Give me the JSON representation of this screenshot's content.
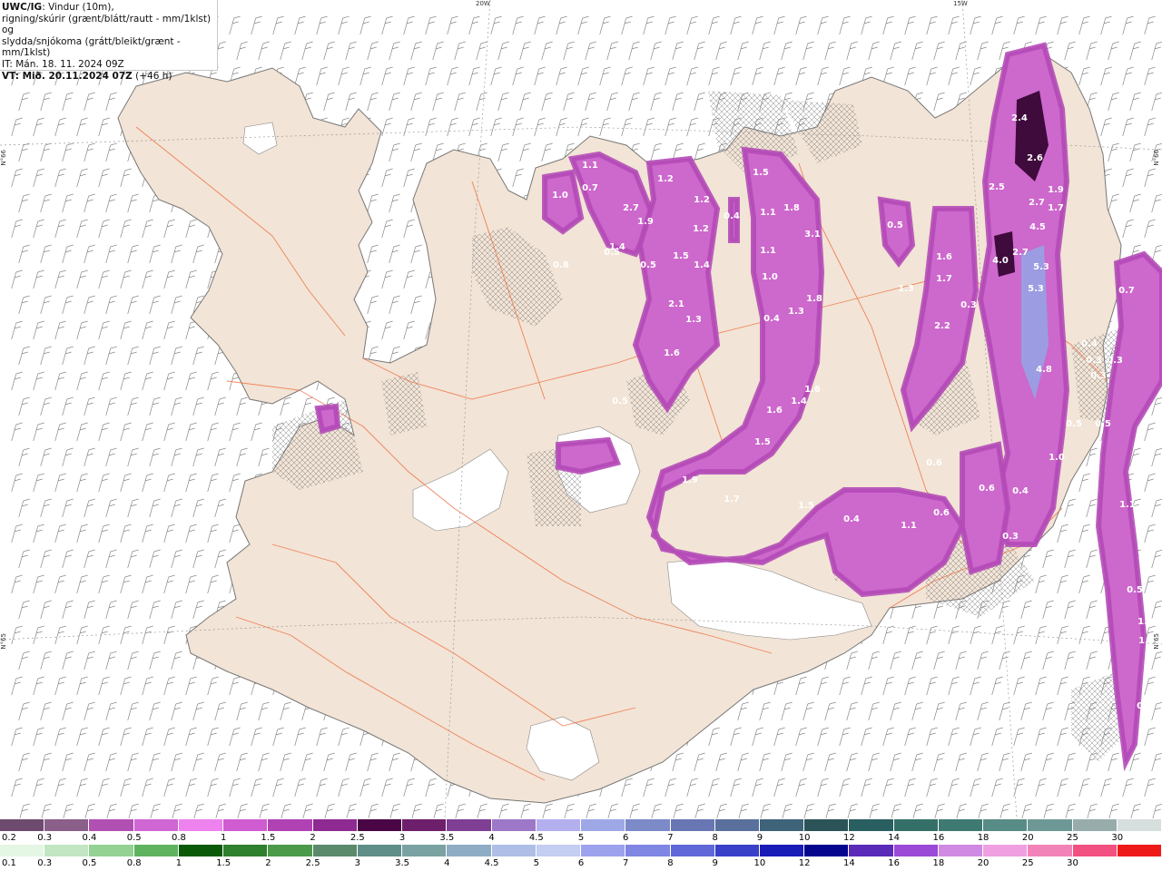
{
  "header": {
    "title_bold": "UWC/IG",
    "line1_rest": ": Vindur (10m),",
    "line2": "rigning/skúrir (grænt/blátt/rautt - mm/1klst) og",
    "line3": "slydda/snjókoma (grátt/bleikt/grænt - mm/1klst)",
    "line4": "IT: Mán. 18. 11. 2024 09Z",
    "line5_bold": "VT: Mið. 20.11.2024 07Z",
    "line5_rest": " (+46 h)"
  },
  "graticule": {
    "lon_labels": [
      "20W",
      "15W"
    ],
    "lat_labels_left": [
      "N°66",
      "N°65"
    ],
    "lat_labels_right": [
      "N°66",
      "N°65"
    ]
  },
  "colors": {
    "sea": "#ffffff",
    "land": "#f2e4d6",
    "coast": "#777777",
    "roads": "#ee6a3a",
    "glacier": "#ffffff",
    "precip_light": "#ee82ee",
    "precip_medium": "#b54ab8",
    "precip_heavy": "#6c1f67",
    "precip_dark": "#3f0a3c",
    "precip_blue": "#9c9ce2"
  },
  "precip_values": [
    "1.1",
    "1.0",
    "0.7",
    "0.8",
    "1.2",
    "2.7",
    "1.9",
    "1.4",
    "1.2",
    "1.2",
    "1.4",
    "1.5",
    "0.5",
    "0.5",
    "2.1",
    "1.3",
    "1.6",
    "0.4",
    "1.5",
    "1.1",
    "1.8",
    "3.1",
    "1.1",
    "1.0",
    "0.4",
    "1.3",
    "1.8",
    "1.4",
    "1.6",
    "1.5",
    "1.6",
    "1.9",
    "0.5",
    "1.7",
    "1.5",
    "0.4",
    "1.1",
    "0.6",
    "0.5",
    "1.3",
    "1.6",
    "1.7",
    "0.3",
    "2.2",
    "2.4",
    "2.6",
    "2.5",
    "1.9",
    "2.7",
    "1.7",
    "4.5",
    "4.0",
    "2.7",
    "5.3",
    "5.3",
    "4.8",
    "0.3",
    "0.4",
    "0.3",
    "0.7",
    "0.6",
    "0.6",
    "0.4",
    "1.0",
    "0.3",
    "1.1",
    "0.5",
    "1.3",
    "1.6",
    "0.5",
    "0.3",
    "0.5",
    "0.5"
  ],
  "legend_snow": {
    "labels": [
      "0.2",
      "0.3",
      "0.4",
      "0.5",
      "0.8",
      "1",
      "1.5",
      "2",
      "2.5",
      "3",
      "3.5",
      "4",
      "4.5",
      "5",
      "6",
      "7",
      "8",
      "9",
      "10",
      "12",
      "14",
      "16",
      "18",
      "20",
      "25",
      "30"
    ],
    "colors": [
      "#6e4a6e",
      "#8a5f8a",
      "#b14fb2",
      "#d066d3",
      "#ee82ee",
      "#cf5cd0",
      "#b042b4",
      "#8e2a91",
      "#4a0644",
      "#6e1f6b",
      "#7e3f94",
      "#9d78c8",
      "#b4b0ef",
      "#9fa8e6",
      "#7c8ac8",
      "#6876b4",
      "#59709c",
      "#3f6378",
      "#2c5458",
      "#295f60",
      "#357068",
      "#3e7a72",
      "#588c86",
      "#6e9896",
      "#98acac",
      "#d6dede"
    ]
  },
  "legend_rain": {
    "labels": [
      "0.1",
      "0.3",
      "0.5",
      "0.8",
      "1",
      "1.5",
      "2",
      "2.5",
      "3",
      "3.5",
      "4",
      "4.5",
      "5",
      "6",
      "7",
      "8",
      "9",
      "10",
      "12",
      "14",
      "16",
      "18",
      "20",
      "25",
      "30"
    ],
    "colors": [
      "#e4f6e4",
      "#c2e6c2",
      "#93d293",
      "#5fb35f",
      "#0a5a0a",
      "#2e7f2e",
      "#4a9a4a",
      "#5a8a6a",
      "#5f8e88",
      "#7aa2a2",
      "#8eacc4",
      "#aebee6",
      "#c4cdf2",
      "#9ca2ec",
      "#7f86e4",
      "#6068d8",
      "#3a40c8",
      "#1a1cb8",
      "#05058e",
      "#5a2ab8",
      "#9a4ad6",
      "#d08ae4",
      "#f0a0e0",
      "#f283b8",
      "#f25080",
      "#ee1a1a"
    ]
  }
}
